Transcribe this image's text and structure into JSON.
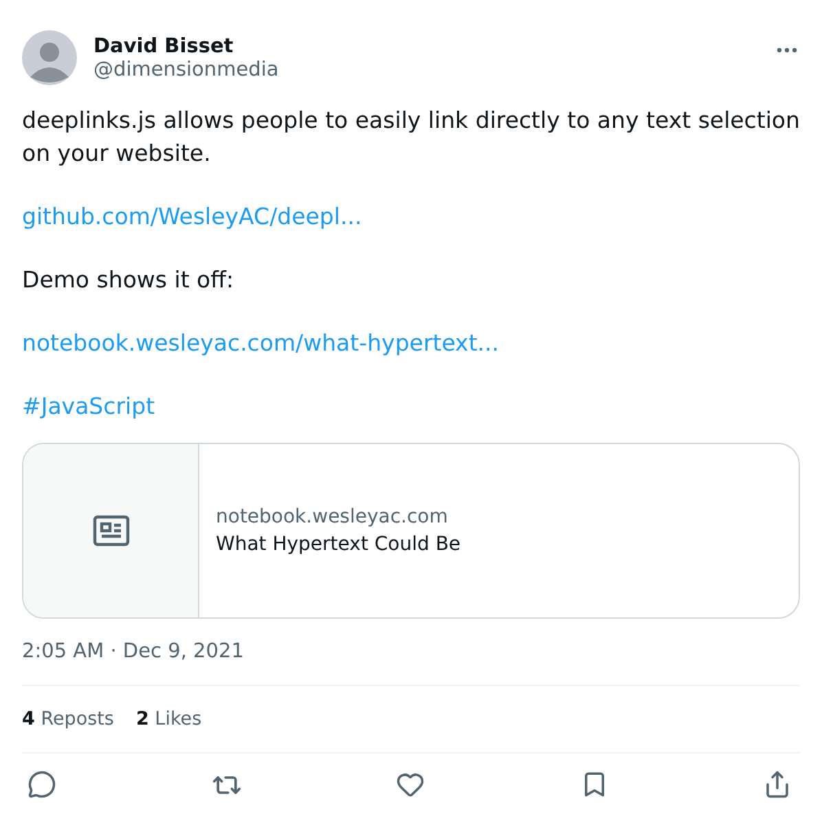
{
  "author": {
    "name": "David Bisset",
    "handle": "@dimensionmedia"
  },
  "body": [
    {
      "kind": "text",
      "text": "deeplinks.js allows people to easily link directly to any text selection on your website."
    },
    {
      "kind": "link",
      "text": "github.com/WesleyAC/deepl..."
    },
    {
      "kind": "text",
      "text": "Demo shows it off:"
    },
    {
      "kind": "link",
      "text": "notebook.wesleyac.com/what-hypertext..."
    },
    {
      "kind": "hashtag",
      "text": "#JavaScript"
    }
  ],
  "card": {
    "domain": "notebook.wesleyac.com",
    "title": "What Hypertext Could Be"
  },
  "timestamp": "2:05 AM · Dec 9, 2021",
  "stats": [
    "**4** Reposts",
    "**2** Likes"
  ]
}
